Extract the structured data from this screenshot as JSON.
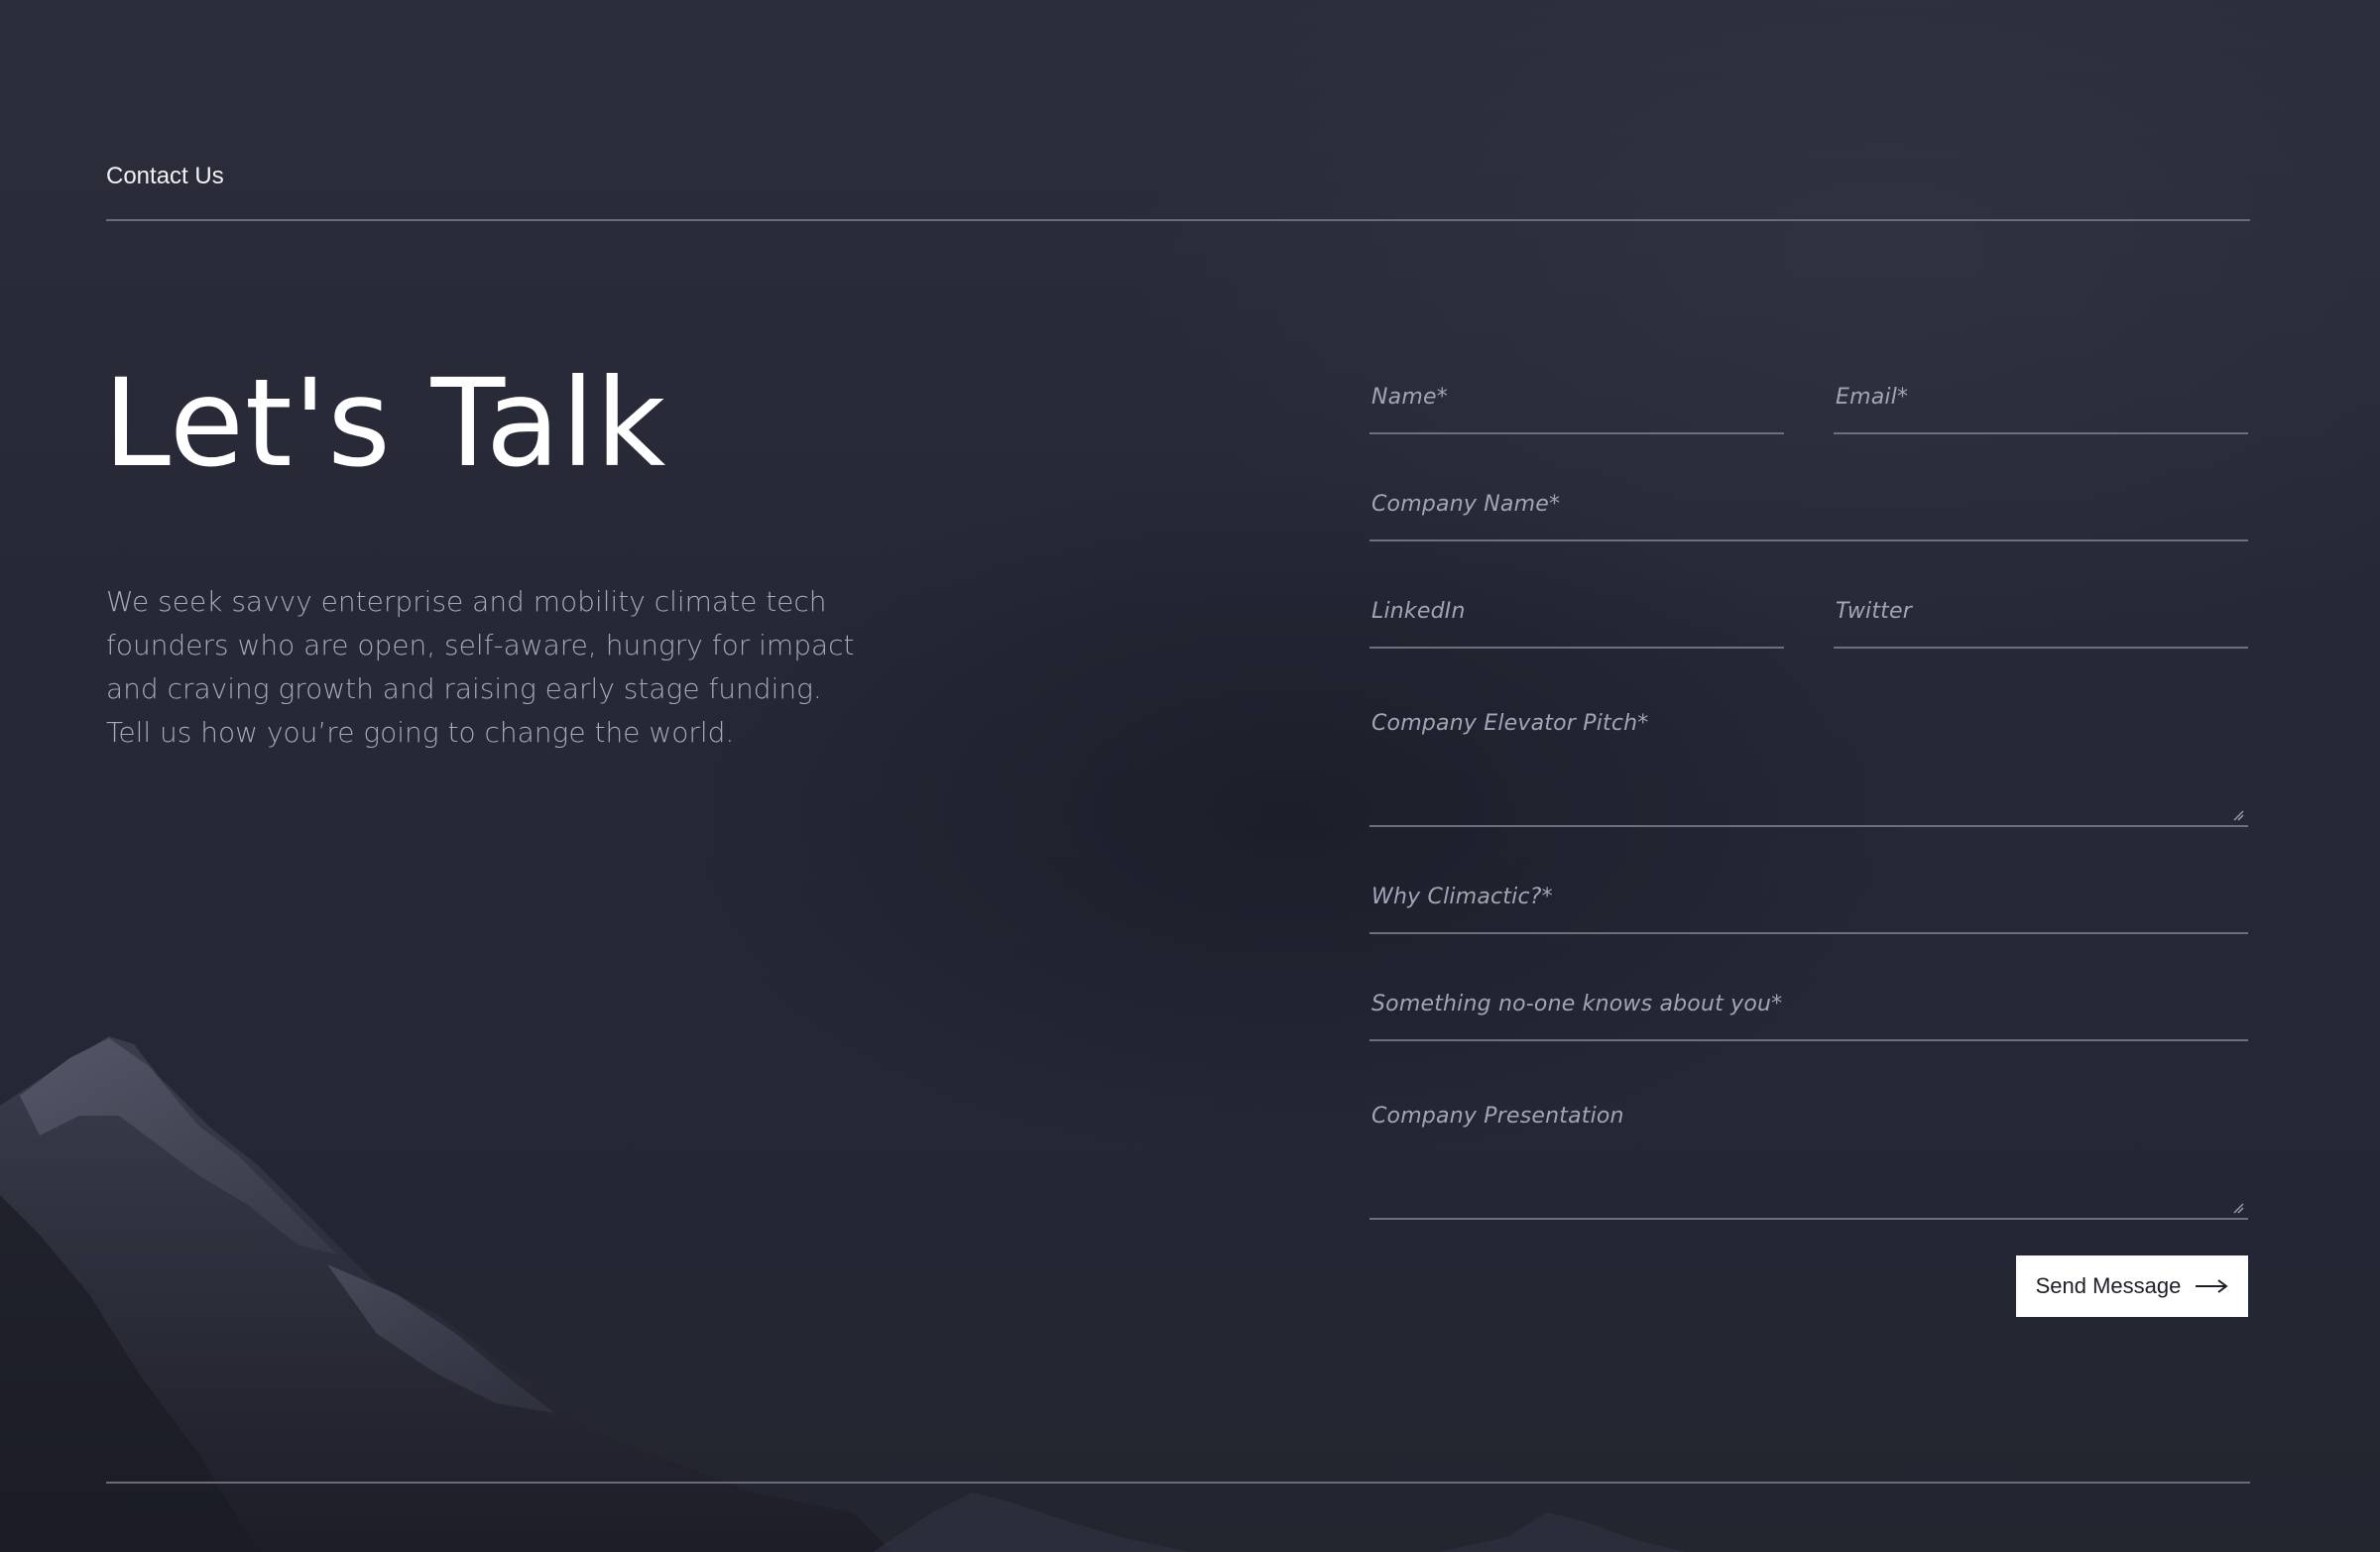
{
  "section": {
    "label": "Contact Us"
  },
  "hero": {
    "title": "Let's Talk",
    "intro": "We seek savvy enterprise and mobility climate tech founders who are open, self-aware, hungry for impact and craving growth and raising early stage funding. Tell us how you’re going to change the world."
  },
  "form": {
    "fields": [
      {
        "label": "Name*",
        "type": "text"
      },
      {
        "label": "Email*",
        "type": "text"
      },
      {
        "label": "Company Name*",
        "type": "text"
      },
      {
        "label": "LinkedIn",
        "type": "text"
      },
      {
        "label": "Twitter",
        "type": "text"
      },
      {
        "label": "Company Elevator Pitch*",
        "type": "textarea"
      },
      {
        "label": "Why Climactic?*",
        "type": "text"
      },
      {
        "label": "Something no-one knows about you*",
        "type": "text"
      },
      {
        "label": "Company Presentation",
        "type": "textarea"
      }
    ],
    "submit_label": "Send Message",
    "submit_icon": "arrow-right-icon"
  },
  "colors": {
    "background": "#262836",
    "divider": "#6a6c7a",
    "text_muted": "#a7a9b7",
    "button_bg": "#ffffff",
    "button_text": "#1e1f29"
  }
}
